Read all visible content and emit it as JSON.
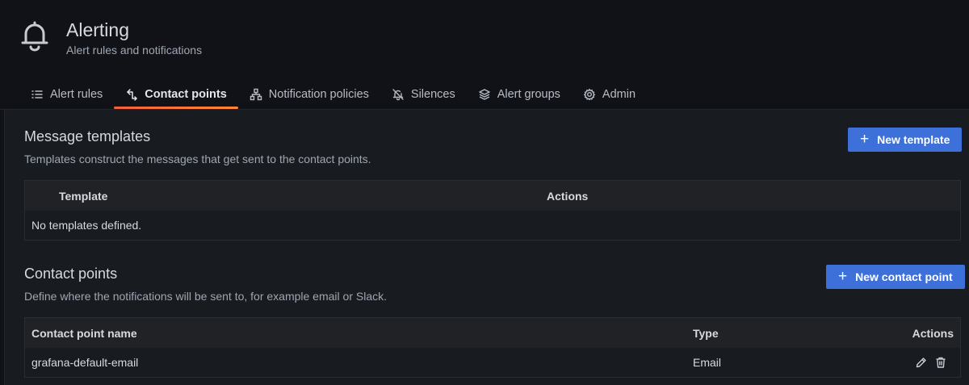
{
  "header": {
    "title": "Alerting",
    "subtitle": "Alert rules and notifications",
    "icon": "bell-icon"
  },
  "tabs": [
    {
      "label": "Alert rules",
      "icon": "list-icon",
      "active": false
    },
    {
      "label": "Contact points",
      "icon": "comment-alt-share-icon",
      "active": true
    },
    {
      "label": "Notification policies",
      "icon": "sitemap-icon",
      "active": false
    },
    {
      "label": "Silences",
      "icon": "bell-slash-icon",
      "active": false
    },
    {
      "label": "Alert groups",
      "icon": "layer-group-icon",
      "active": false
    },
    {
      "label": "Admin",
      "icon": "cog-icon",
      "active": false
    }
  ],
  "templates": {
    "title": "Message templates",
    "description": "Templates construct the messages that get sent to the contact points.",
    "new_button": "New template",
    "columns": {
      "template": "Template",
      "actions": "Actions"
    },
    "empty_text": "No templates defined."
  },
  "contact_points": {
    "title": "Contact points",
    "description": "Define where the notifications will be sent to, for example email or Slack.",
    "new_button": "New contact point",
    "columns": {
      "name": "Contact point name",
      "type": "Type",
      "actions": "Actions"
    },
    "rows": [
      {
        "name": "grafana-default-email",
        "type": "Email"
      }
    ]
  },
  "colors": {
    "primary": "#3d71d9",
    "active_tab_underline": "#f55f3e",
    "background": "#111217",
    "panel": "#181b1f"
  }
}
